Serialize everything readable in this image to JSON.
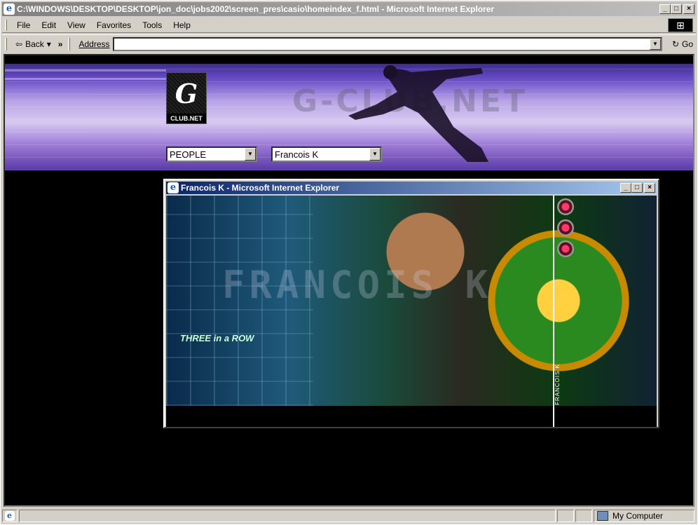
{
  "window": {
    "title": "C:\\WINDOWS\\DESKTOP\\DESKTOP\\jon_doc\\jobs2002\\screen_pres\\casio\\homeindex_f.html - Microsoft Internet Explorer"
  },
  "menu": [
    "File",
    "Edit",
    "View",
    "Favorites",
    "Tools",
    "Help"
  ],
  "toolbar": {
    "back_label": "Back",
    "more": "»",
    "address_label": "Address",
    "address_value": "",
    "go_label": "Go"
  },
  "banner": {
    "logo_caption": "CLUB.NET",
    "logo_glyph": "G",
    "watermark": "G-CLUB.NET",
    "select_category": "PEOPLE",
    "select_person": "Francois K"
  },
  "popup": {
    "title": "Francois K - Microsoft Internet Explorer",
    "photo_ghost_text": "FRANCOIS K",
    "photo_row_text": "THREE in a ROW",
    "vertical_label": "FRANCOIS K"
  },
  "statusbar": {
    "status_text": "",
    "zone_text": "My Computer"
  },
  "colors": {
    "titlebar_active": "#0a246a",
    "titlebar_inactive": "#808080",
    "chrome": "#d4d0c8"
  }
}
